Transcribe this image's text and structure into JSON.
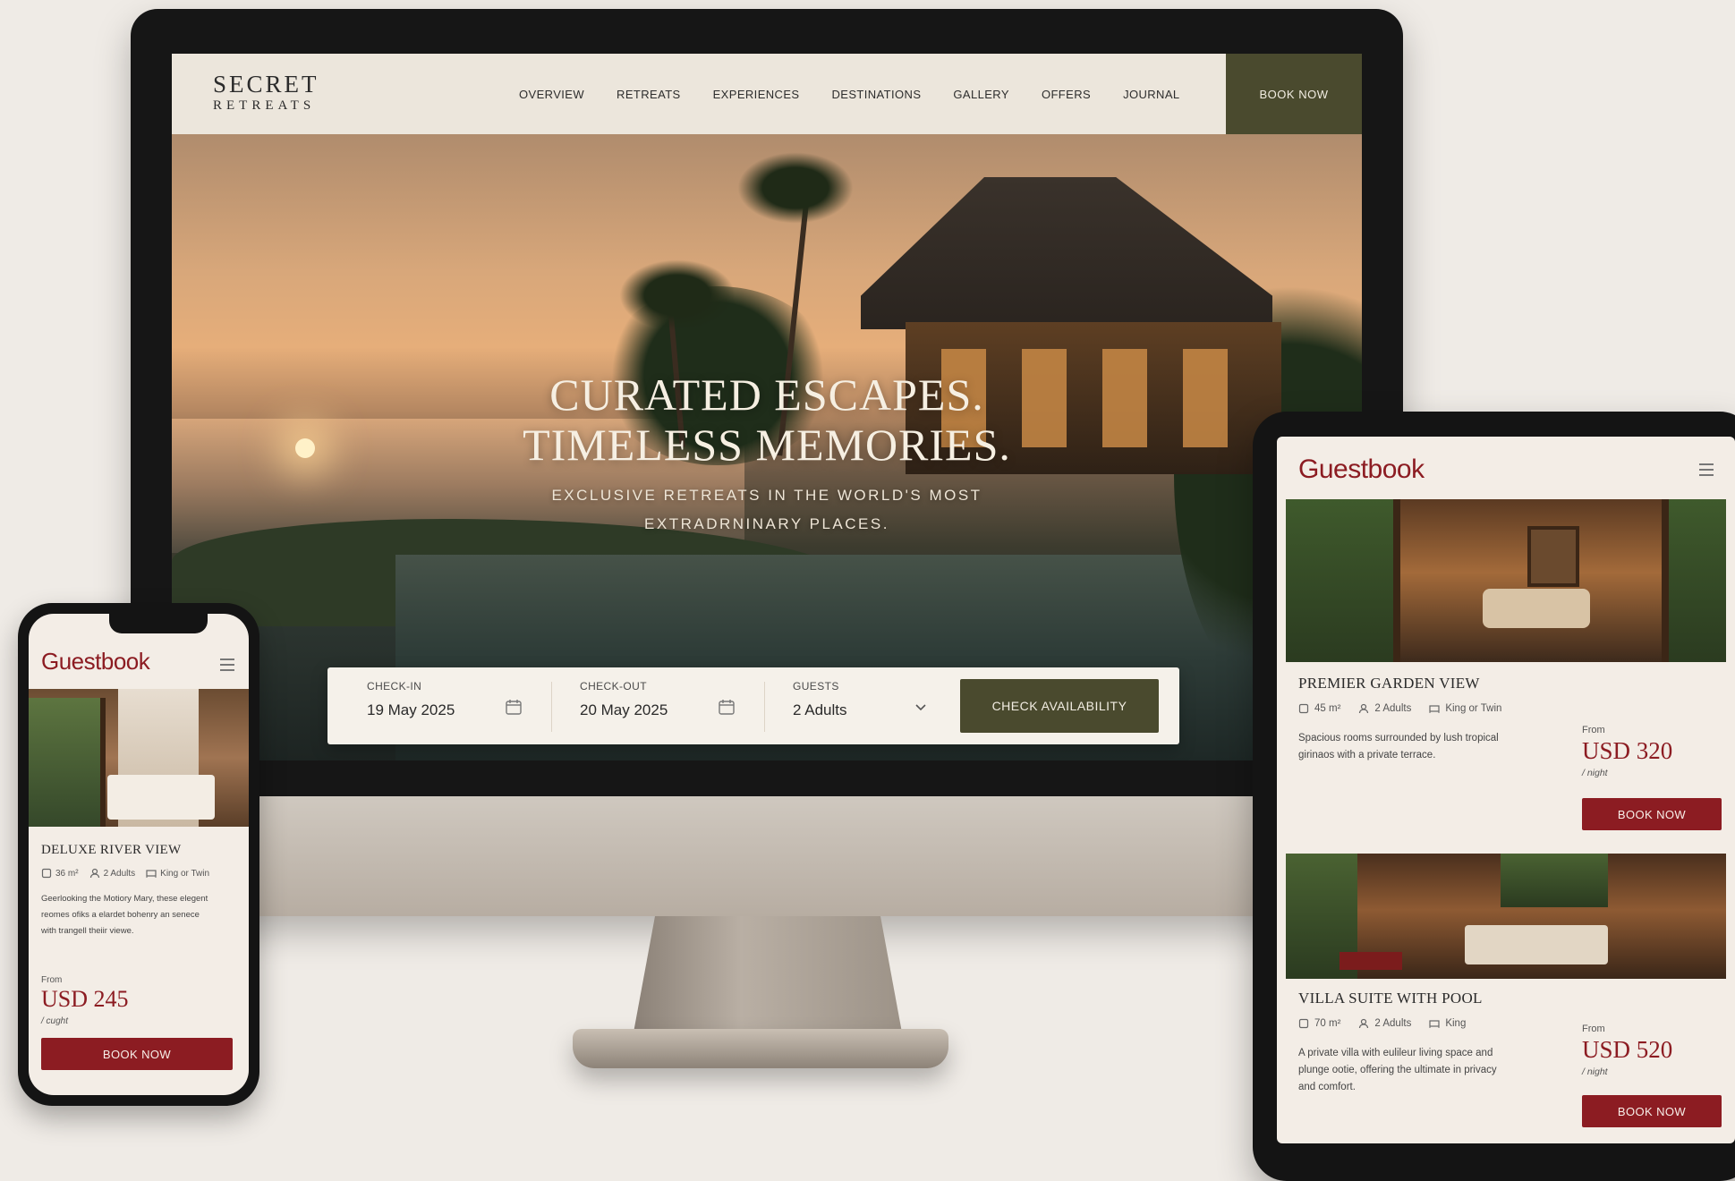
{
  "desktop": {
    "logo": {
      "line1": "SECRET",
      "line2": "RETREATS"
    },
    "nav": [
      "OVERVIEW",
      "RETREATS",
      "EXPERIENCES",
      "DESTINATIONS",
      "GALLERY",
      "OFFERS",
      "JOURNAL"
    ],
    "nav_book": "BOOK NOW",
    "hero": {
      "title_line1": "CURATED ESCAPES.",
      "title_line2": "TIMELESS MEMORIES.",
      "subtitle_line1": "EXCLUSIVE RETREATS IN THE WORLD'S MOST",
      "subtitle_line2": "EXTRADRNINARY PLACES."
    },
    "booking": {
      "checkin_label": "CHECK-IN",
      "checkin_value": "19 May 2025",
      "checkout_label": "CHECK-OUT",
      "checkout_value": "20 May 2025",
      "guests_label": "GUESTS",
      "guests_value": "2 Adults",
      "button": "CHECK AVAILABILITY"
    }
  },
  "tablet": {
    "logo": "Guestbook",
    "rooms": [
      {
        "title": "PREMIER GARDEN VIEW",
        "size": "45 m²",
        "guests": "2 Adults",
        "bed": "King or Twin",
        "desc_line1": "Spacious rooms surrounded by lush tropical",
        "desc_line2": "girinaos with a private terrace.",
        "from": "From",
        "price": "USD 320",
        "per": "/ night",
        "button": "BOOK NOW"
      },
      {
        "title": "VILLA SUITE WITH POOL",
        "size": "70 m²",
        "guests": "2 Adults",
        "bed": "King",
        "desc_line1": "A private villa with eulileur living space and",
        "desc_line2": "plunge ootie, offering the ultimate in privacy",
        "desc_line3": "and comfort.",
        "from": "From",
        "price": "USD 520",
        "per": "/ night",
        "button": "BOOK NOW"
      }
    ]
  },
  "phone": {
    "logo": "Guestbook",
    "room": {
      "title": "DELUXE RIVER VIEW",
      "size": "36 m²",
      "guests": "2 Adults",
      "bed": "King or Twin",
      "desc_line1": "Geerlooking the Motiory Mary, these elegent",
      "desc_line2": "reomes ofiks a elardet bohenry an senece",
      "desc_line3": "with trangell theiir viewe.",
      "from": "From",
      "price": "USD 245",
      "per": "/ cught",
      "button": "BOOK NOW"
    }
  },
  "colors": {
    "brand_olive": "#4a4a2e",
    "brand_red": "#8c1c22",
    "cream": "#f3ede6"
  }
}
